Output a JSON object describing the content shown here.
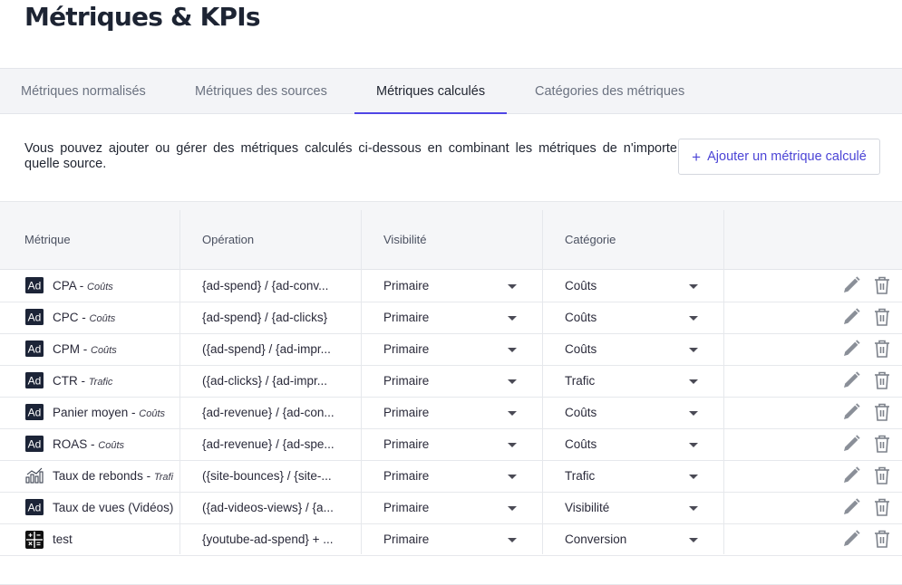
{
  "page": {
    "title": "Métriques & KPIs"
  },
  "tabs": [
    {
      "label": "Métriques normalisés"
    },
    {
      "label": "Métriques des sources"
    },
    {
      "label": "Métriques calculés"
    },
    {
      "label": "Catégories des métriques"
    }
  ],
  "active_tab": "Métriques calculés",
  "description": "Vous pouvez ajouter ou gérer des métriques calculés ci-dessous en combinant les métriques de n'importe quelle source.",
  "add_button": {
    "icon": "plus-icon",
    "label": "Ajouter un métrique calculé"
  },
  "table": {
    "headers": {
      "metric": "Métrique",
      "operation": "Opération",
      "visibility": "Visibilité",
      "category": "Catégorie"
    },
    "rows": [
      {
        "icon": "ad-icon",
        "name": "CPA",
        "sep": " - ",
        "category_tag": "Coûts",
        "operation": "{ad-spend} / {ad-conv...",
        "visibility": "Primaire",
        "category": "Coûts"
      },
      {
        "icon": "ad-icon",
        "name": "CPC",
        "sep": " - ",
        "category_tag": "Coûts",
        "operation": "{ad-spend} / {ad-clicks}",
        "visibility": "Primaire",
        "category": "Coûts"
      },
      {
        "icon": "ad-icon",
        "name": "CPM",
        "sep": " - ",
        "category_tag": "Coûts",
        "operation": "({ad-spend} / {ad-impr...",
        "visibility": "Primaire",
        "category": "Coûts"
      },
      {
        "icon": "ad-icon",
        "name": "CTR",
        "sep": " - ",
        "category_tag": "Trafic",
        "operation": "({ad-clicks} / {ad-impr...",
        "visibility": "Primaire",
        "category": "Trafic"
      },
      {
        "icon": "ad-icon",
        "name": "Panier moyen",
        "sep": " - ",
        "category_tag": "Coûts",
        "operation": "{ad-revenue} / {ad-con...",
        "visibility": "Primaire",
        "category": "Coûts"
      },
      {
        "icon": "ad-icon",
        "name": "ROAS",
        "sep": " - ",
        "category_tag": "Coûts",
        "operation": "{ad-revenue} / {ad-spe...",
        "visibility": "Primaire",
        "category": "Coûts"
      },
      {
        "icon": "analytics-chart-icon",
        "name": "Taux de rebonds",
        "sep": " - ",
        "category_tag": "Trafi",
        "operation": "({site-bounces} / {site-...",
        "visibility": "Primaire",
        "category": "Trafic"
      },
      {
        "icon": "ad-icon",
        "name": "Taux de vues (Vidéos)",
        "sep": "",
        "category_tag": "",
        "operation": "({ad-videos-views} / {a...",
        "visibility": "Primaire",
        "category": "Visibilité"
      },
      {
        "icon": "calculator-icon",
        "name": "test",
        "sep": "",
        "category_tag": "",
        "operation": "{youtube-ad-spend} + ...",
        "visibility": "Primaire",
        "category": "Conversion"
      }
    ]
  },
  "icons": {
    "ad_text": "Ad",
    "edit": "pencil-icon",
    "delete": "trash-icon",
    "dropdown": "chevron-down-icon"
  },
  "colors": {
    "accent": "#5046e5",
    "icon_dark": "#1c2437",
    "action_gray": "#8a8f98"
  }
}
